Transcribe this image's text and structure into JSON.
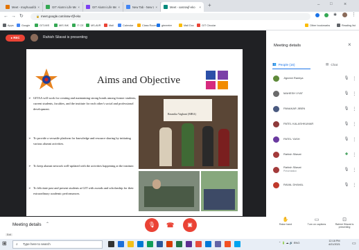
{
  "browser": {
    "tabs": [
      {
        "title": "Meet - mayhuuufdadjofu",
        "color": "#e37400"
      },
      {
        "title": "GIT Alumni Life Membership",
        "color": "#34a853"
      },
      {
        "title": "GIT Alumni Life Membership",
        "color": "#7b3ff2"
      },
      {
        "title": "New Tab - New tab",
        "color": "#4285f4"
      },
      {
        "title": "Meet - xasrowjf-eko",
        "color": "#00897b"
      }
    ],
    "url": "meet.google.com/xsw-rfjf-eko",
    "bookmarks": [
      "Apps",
      "Google",
      "GIT-MIS",
      "MIS INK",
      "IT CE",
      "MS-AVR",
      "Mail",
      "Calendar",
      "Class Room",
      "gtmeeter",
      "Mail Doc",
      "GIT Circular",
      "Other bookmarks",
      "Reading list"
    ]
  },
  "meet": {
    "rec_label": "REC",
    "presenting": "Rahish Silavat is presenting",
    "panel_title": "Meeting details",
    "tab_people": "People (16)",
    "tab_chat": "Chat",
    "participants": [
      {
        "name": "Jignesh Ramiya",
        "sub": "",
        "color": "#5f8a3a"
      },
      {
        "name": "MAHESH VYAT",
        "sub": "",
        "color": "#6b6b6b"
      },
      {
        "name": "PANAKAR JIBEN",
        "sub": "",
        "color": "#4a5a80"
      },
      {
        "name": "PATEL KALASHKUMAR",
        "sub": "",
        "color": "#8e3a3a"
      },
      {
        "name": "PATEL YASH",
        "sub": "",
        "color": "#6a3aa0"
      },
      {
        "name": "Rahish Silavat",
        "sub": "",
        "color": "#a33a3a"
      },
      {
        "name": "Rahish Silavat",
        "sub": "Presentation",
        "color": "#a33a3a"
      },
      {
        "name": "RAVAL DHAVAL",
        "sub": "",
        "color": "#c0392b"
      }
    ],
    "meeting_details": "Meeting details",
    "actions": {
      "raise": "Raise hand",
      "captions": "Turn on captions",
      "present": "Rahish Silavat is presenting"
    }
  },
  "slide": {
    "title": "Aims and Objective",
    "banner": "Rasmika Vaghani (MBA)",
    "bullets": [
      "GITAA will work for creating and maintaining strong bonds among former students, current students, faculties, and the institute for each other's social and professional development.",
      "To provide a versatile platform for knowledge and resource sharing by initiating various alumni activities.",
      "To keep alumni network well-updated with the activities happening at the institute.",
      "To felicitate past and present students at GIT with awards and scholarship for their extraordinary academic performances."
    ]
  },
  "taskbar": {
    "search_placeholder": "Type here to search",
    "tray": "ENG",
    "time": "12:18 PM",
    "date": "4/21/2021"
  }
}
